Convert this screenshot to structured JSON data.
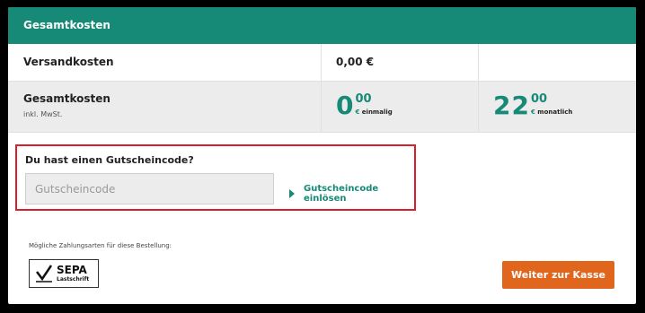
{
  "header": {
    "title": "Gesamtkosten"
  },
  "shipping": {
    "label": "Versandkosten",
    "value": "0,00 €"
  },
  "total": {
    "label": "Gesamtkosten",
    "sublabel": "inkl. MwSt.",
    "one_time": {
      "whole": "0",
      "cents": "00",
      "currency": "€",
      "period": "einmalig"
    },
    "monthly": {
      "whole": "22",
      "cents": "00",
      "currency": "€",
      "period": "monatlich"
    }
  },
  "coupon": {
    "title": "Du hast einen Gutscheincode?",
    "placeholder": "Gutscheincode",
    "value": "",
    "redeem_label": "Gutscheincode einlösen"
  },
  "payment": {
    "note": "Mögliche Zahlungsarten für diese Bestellung:",
    "methods": [
      {
        "title": "SEPA",
        "subtitle": "Lastschrift",
        "icon": "sepa-logo"
      }
    ]
  },
  "checkout": {
    "label": "Weiter zur Kasse"
  },
  "colors": {
    "brand": "#168a76",
    "cta": "#e1661d",
    "highlight_border": "#d81f2a"
  }
}
